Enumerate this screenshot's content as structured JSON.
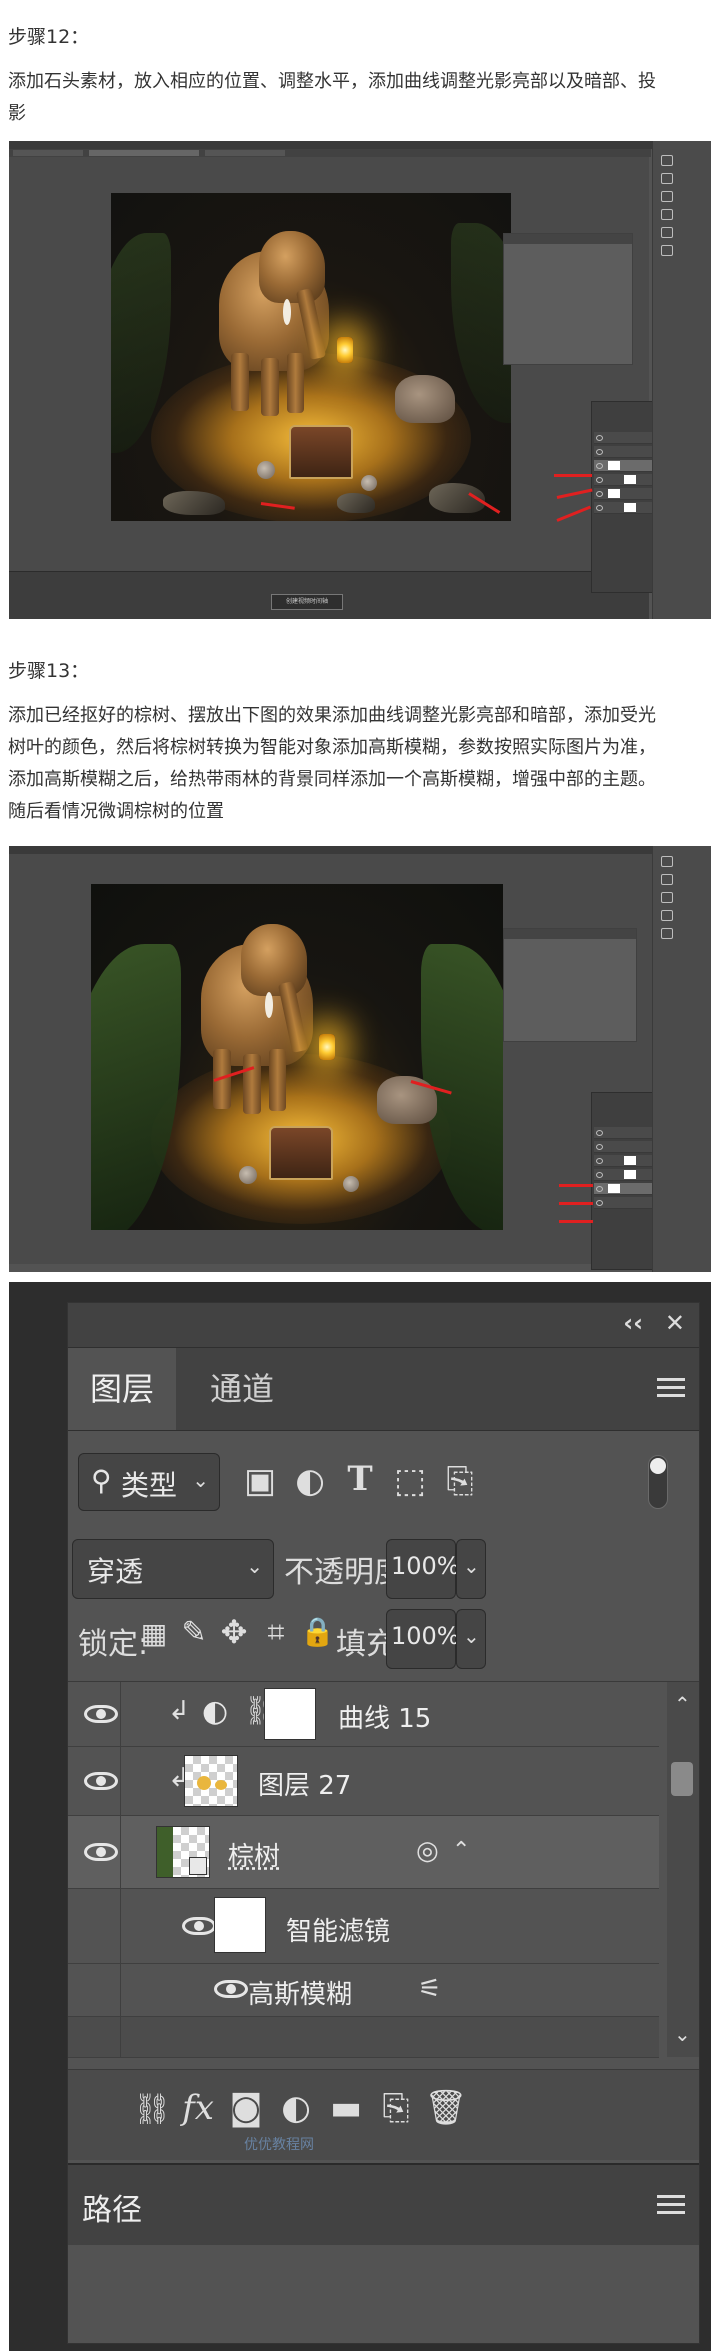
{
  "step12": {
    "heading": "步骤12：",
    "body_line1": "添加石头素材，放入相应的位置、调整水平，添加曲线调整光影亮部以及暗部、投",
    "body_line2": "影",
    "ps_status_text": "创建视频时间轴"
  },
  "step13": {
    "heading": "步骤13：",
    "body_line1": "添加已经抠好的棕树、摆放出下图的效果添加曲线调整光影亮部和暗部，添加受光",
    "body_line2": "树叶的颜色，然后将棕树转换为智能对象添加高斯模糊，参数按照实际图片为准，",
    "body_line3": "添加高斯模糊之后，给热带雨林的背景同样添加一个高斯模糊，增强中部的主题。",
    "body_line4": "随后看情况微调棕树的位置"
  },
  "layers_panel": {
    "collapse_glyph": "‹‹",
    "close_glyph": "✕",
    "tab_layers": "图层",
    "tab_channels": "通道",
    "filter_label": "类型",
    "blend_mode": "穿透",
    "opacity_label": "不透明度:",
    "opacity_value": "100%",
    "lock_label": "锁定:",
    "fill_label": "填充:",
    "fill_value": "100%",
    "layers": [
      {
        "name": "曲线 15"
      },
      {
        "name": "图层 27"
      },
      {
        "name": "棕树"
      },
      {
        "name": "智能滤镜"
      },
      {
        "name": "高斯模糊"
      }
    ],
    "paths_tab": "路径",
    "footer_fx": "fx",
    "watermark": "优优教程网"
  },
  "colors": {
    "ps_gray": "#535353",
    "panel_dark": "#424242",
    "arrow_red": "#e02020",
    "glow": "#ffc43c"
  }
}
